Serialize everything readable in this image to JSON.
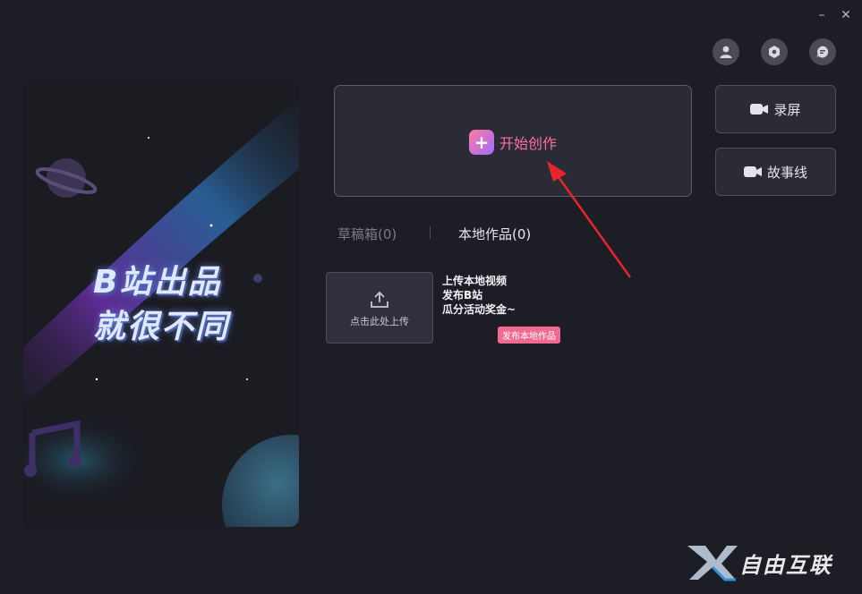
{
  "window": {
    "minimize_glyph": "–",
    "close_glyph": "✕"
  },
  "header_icons": [
    "user-icon",
    "settings-icon",
    "feedback-icon"
  ],
  "banner": {
    "line1": "B站出品",
    "line2": "就很不同"
  },
  "start": {
    "plus": "+",
    "label": "开始创作"
  },
  "side_buttons": {
    "record": "录屏",
    "story": "故事线"
  },
  "tabs": {
    "drafts": "草稿箱(0)",
    "local": "本地作品(0)"
  },
  "upload": {
    "label": "点击此处上传"
  },
  "promo": {
    "line1": "上传本地视频",
    "line2": "发布B站",
    "line3": "瓜分活动奖金~",
    "badge": "发布本地作品"
  },
  "watermark": {
    "text": "自由互联"
  },
  "colors": {
    "accent": "#ff6f9c",
    "arrow": "#e8242b",
    "panel": "#2b2b36"
  }
}
